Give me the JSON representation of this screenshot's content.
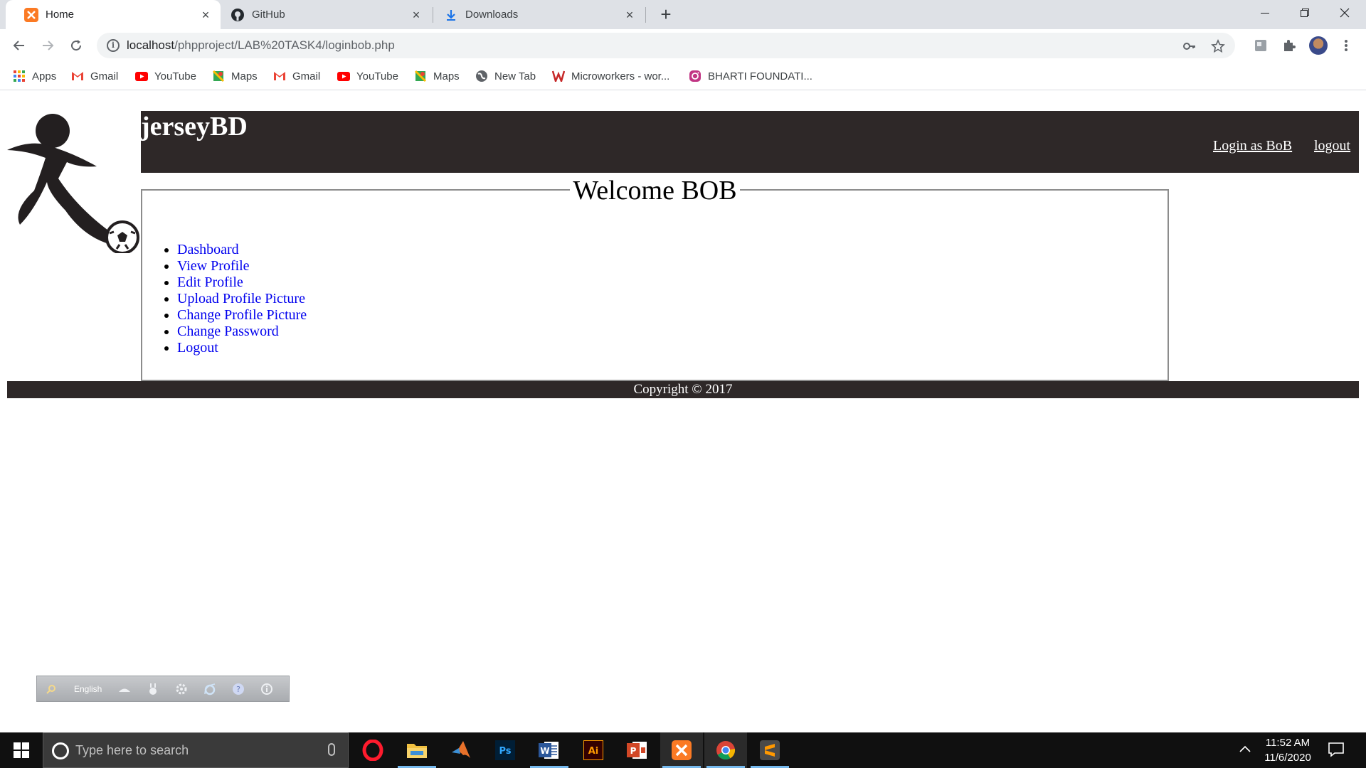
{
  "browser": {
    "tabs": [
      {
        "title": "Home",
        "active": true
      },
      {
        "title": "GitHub",
        "active": false
      },
      {
        "title": "Downloads",
        "active": false
      }
    ],
    "url_host": "localhost",
    "url_path": "/phpproject/LAB%20TASK4/loginbob.php",
    "bookmarks": [
      {
        "label": "Apps",
        "icon": "apps-grid-icon"
      },
      {
        "label": "Gmail",
        "icon": "gmail-icon"
      },
      {
        "label": "YouTube",
        "icon": "youtube-icon"
      },
      {
        "label": "Maps",
        "icon": "maps-icon"
      },
      {
        "label": "Gmail",
        "icon": "gmail-icon"
      },
      {
        "label": "YouTube",
        "icon": "youtube-icon"
      },
      {
        "label": "Maps",
        "icon": "maps-icon"
      },
      {
        "label": "New Tab",
        "icon": "globe-icon"
      },
      {
        "label": "Microworkers - wor...",
        "icon": "microworkers-icon"
      },
      {
        "label": "BHARTI FOUNDATI...",
        "icon": "instagram-icon"
      }
    ]
  },
  "site": {
    "title": "jerseyBD",
    "login_link": "Login as BoB",
    "logout_link": "logout",
    "welcome": "Welcome BOB",
    "menu": [
      "Dashboard",
      "View Profile",
      "Edit Profile",
      "Upload Profile Picture",
      "Change Profile Picture",
      "Change Password",
      "Logout"
    ],
    "footer": "Copyright © 2017",
    "colors": {
      "header_bg": "#2e2828",
      "link": "#0000ee"
    }
  },
  "langbar": {
    "language": "English"
  },
  "taskbar": {
    "search_placeholder": "Type here to search",
    "time": "11:52 AM",
    "date": "11/6/2020"
  }
}
